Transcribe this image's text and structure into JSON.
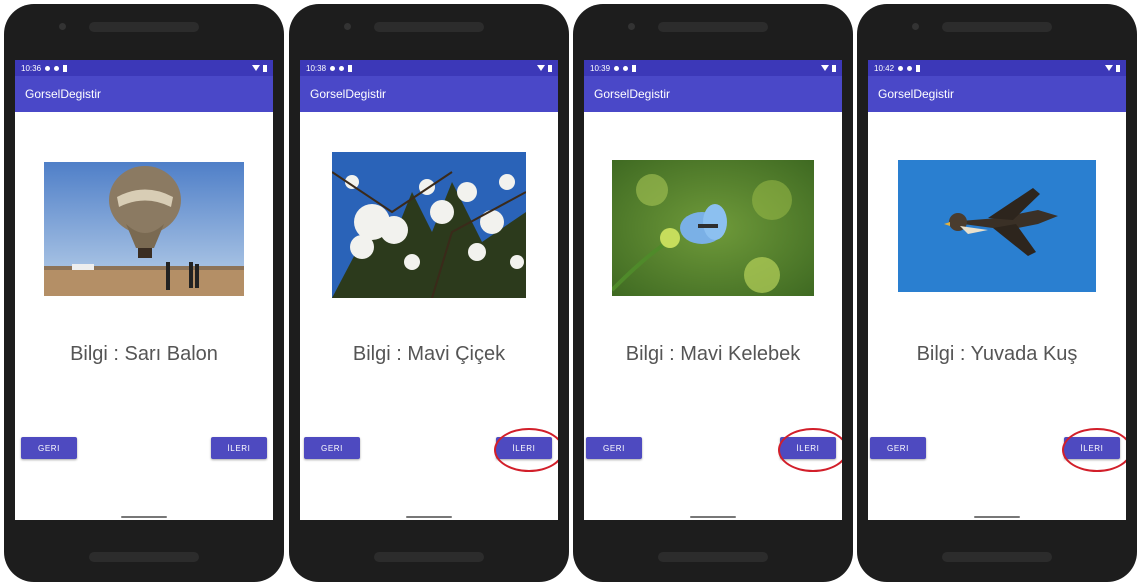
{
  "phones": [
    {
      "time": "10:36",
      "app_title": "GorselDegistir",
      "info_text": "Bilgi : Sarı Balon",
      "back_label": "GERI",
      "next_label": "İLERI",
      "photo": "hot-air-balloon"
    },
    {
      "time": "10:38",
      "app_title": "GorselDegistir",
      "info_text": "Bilgi : Mavi Çiçek",
      "back_label": "GERI",
      "next_label": "İLERI",
      "photo": "white-blossoms"
    },
    {
      "time": "10:39",
      "app_title": "GorselDegistir",
      "info_text": "Bilgi : Mavi Kelebek",
      "back_label": "GERI",
      "next_label": "İLERI",
      "photo": "blue-butterfly"
    },
    {
      "time": "10:42",
      "app_title": "GorselDegistir",
      "info_text": "Bilgi : Yuvada Kuş",
      "back_label": "GERI",
      "next_label": "İLERI",
      "photo": "flying-falcon"
    }
  ],
  "colors": {
    "statusbar": "#3c38b8",
    "appbar": "#4a48c8",
    "button": "#4e4ac0",
    "highlight_circle": "#d21f2a"
  }
}
